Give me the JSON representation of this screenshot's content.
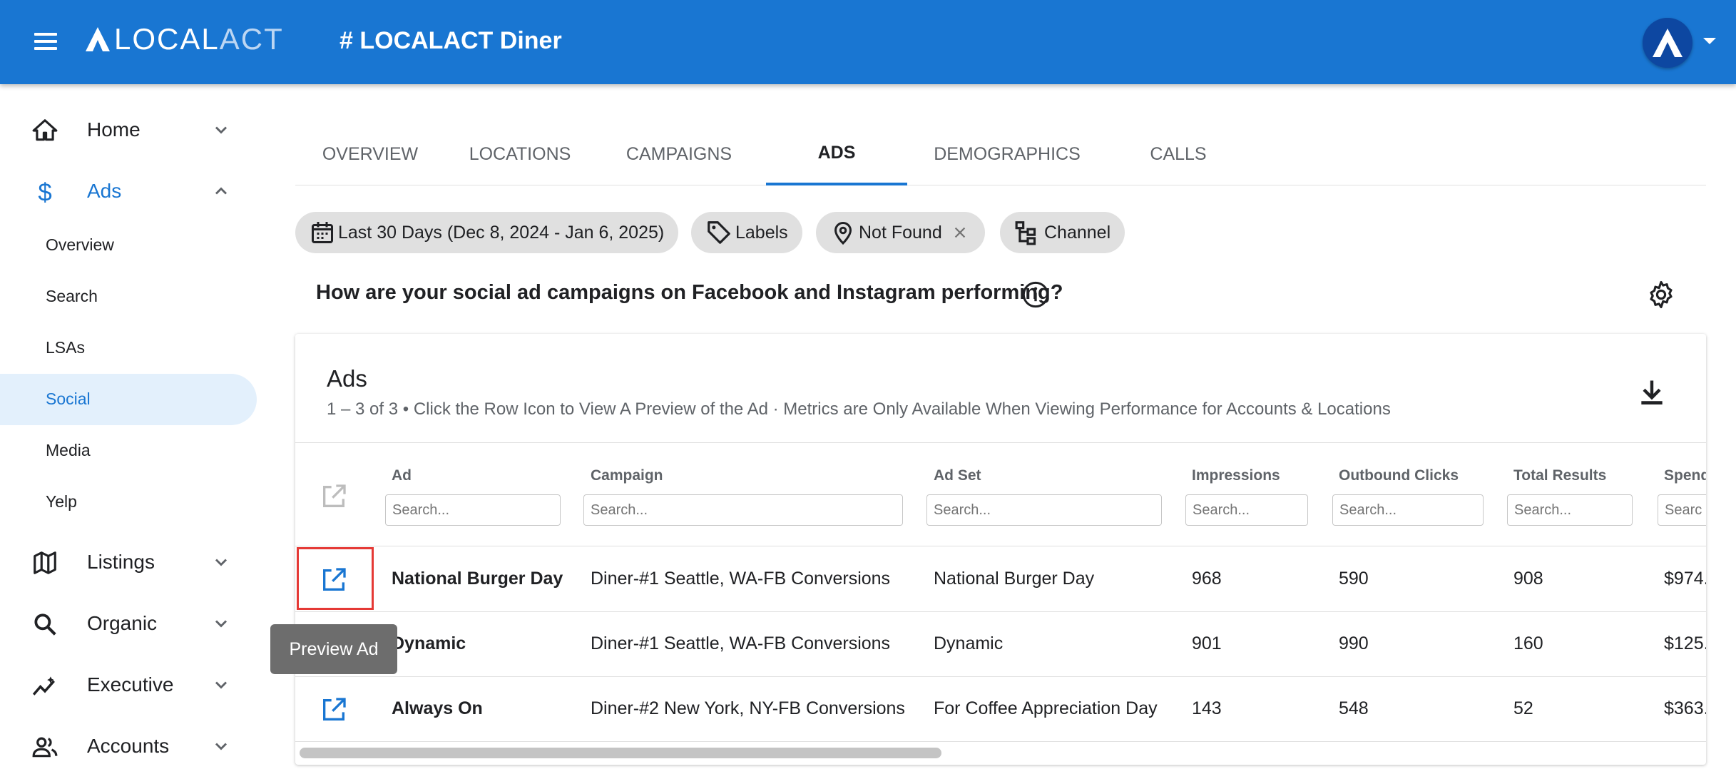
{
  "header": {
    "logo_primary": "LOCAL",
    "logo_secondary": "ACT",
    "title": "# LOCALACT Diner",
    "brand_color": "#1976d2"
  },
  "sidebar": {
    "items": [
      {
        "label": "Home",
        "icon": "home-icon",
        "expanded": false
      },
      {
        "label": "Ads",
        "icon": "dollar-icon",
        "expanded": true
      },
      {
        "label": "Listings",
        "icon": "map-icon",
        "expanded": false
      },
      {
        "label": "Organic",
        "icon": "search-icon",
        "expanded": false
      },
      {
        "label": "Executive",
        "icon": "trend-icon",
        "expanded": false
      },
      {
        "label": "Accounts",
        "icon": "people-icon",
        "expanded": false
      }
    ],
    "ads_subitems": [
      "Overview",
      "Search",
      "LSAs",
      "Social",
      "Media",
      "Yelp"
    ],
    "selected_subitem": "Social"
  },
  "tabs": [
    "OVERVIEW",
    "LOCATIONS",
    "CAMPAIGNS",
    "ADS",
    "DEMOGRAPHICS",
    "CALLS"
  ],
  "active_tab": "ADS",
  "filters": {
    "date": "Last 30 Days (Dec 8, 2024 - Jan 6, 2025)",
    "labels": "Labels",
    "location": "Not Found",
    "channel": "Channel"
  },
  "question": "How are your social ad campaigns on Facebook and Instagram performing?",
  "card": {
    "title": "Ads",
    "subtitle": "1 – 3 of 3 • Click the Row Icon to View A Preview of the Ad · Metrics are Only Available When Viewing Performance for Accounts & Locations"
  },
  "table": {
    "columns": [
      "Ad",
      "Campaign",
      "Ad Set",
      "Impressions",
      "Outbound Clicks",
      "Total Results",
      "Spend"
    ],
    "search_placeholder": "Search...",
    "spend_placeholder_visible": "Searc",
    "rows": [
      {
        "ad": "National Burger Day",
        "campaign": "Diner-#1 Seattle, WA-FB Conversions",
        "ad_set": "National Burger Day",
        "impressions": "968",
        "outbound_clicks": "590",
        "total_results": "908",
        "spend": "$974."
      },
      {
        "ad": "Dynamic",
        "campaign": "Diner-#1 Seattle, WA-FB Conversions",
        "ad_set": "Dynamic",
        "impressions": "901",
        "outbound_clicks": "990",
        "total_results": "160",
        "spend": "$125."
      },
      {
        "ad": "Always On",
        "campaign": "Diner-#2 New York, NY-FB Conversions",
        "ad_set": "For Coffee Appreciation Day",
        "impressions": "143",
        "outbound_clicks": "548",
        "total_results": "52",
        "spend": "$363."
      }
    ]
  },
  "tooltip": "Preview Ad"
}
